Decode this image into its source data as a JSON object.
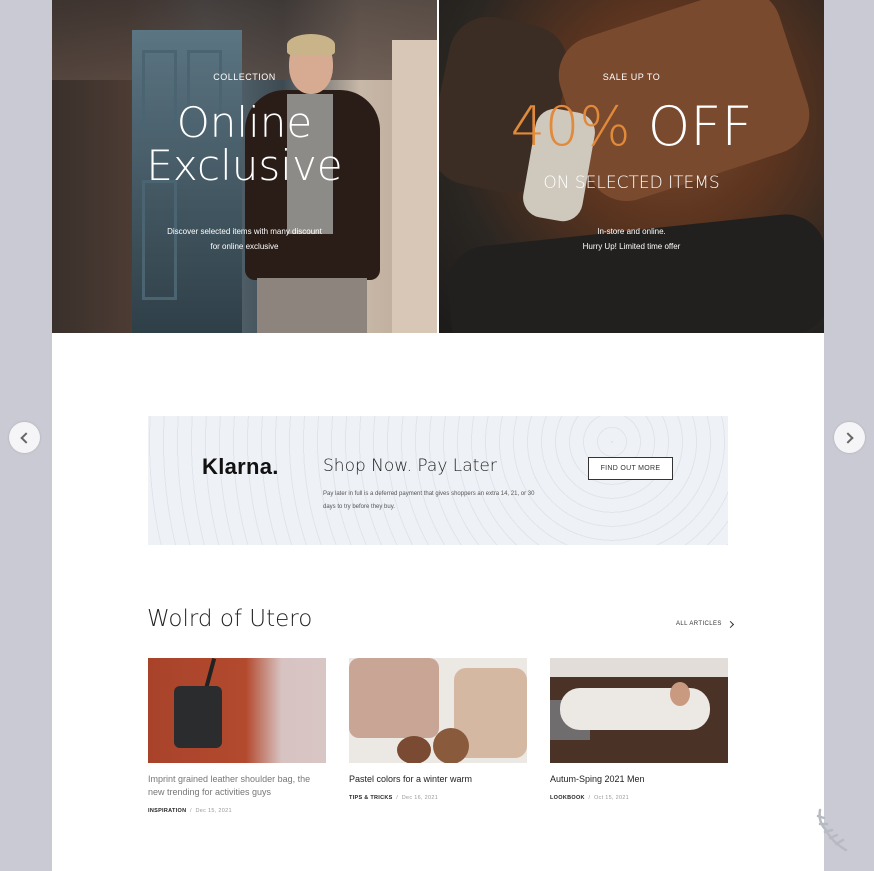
{
  "hero": {
    "left": {
      "label": "COLLECTION",
      "title_line1": "Online",
      "title_line2": "Exclusive",
      "desc_line1": "Discover selected items with many discount",
      "desc_line2": "for online exclusive"
    },
    "right": {
      "label": "SALE UP TO",
      "percent": "40%",
      "off": " OFF",
      "subtitle": "ON SELECTED ITEMS",
      "desc_line1": "In-store and online.",
      "desc_line2": "Hurry Up! Limited time offer"
    }
  },
  "klarna": {
    "logo": "Klarna.",
    "title": "Shop Now. Pay Later",
    "desc": "Pay later in full is a deferred payment that gives shoppers an extra 14, 21, or 30 days to try before they buy.",
    "button": "FIND OUT MORE"
  },
  "articles_section": {
    "title": "Wolrd of Utero",
    "all_link": "ALL ARTICLES",
    "items": [
      {
        "title": "Imprint grained leather shoulder bag, the new trending for activities guys",
        "category": "INSPIRATION",
        "date": "Dec 15, 2021"
      },
      {
        "title": "Pastel colors for a winter warm",
        "category": "TIPS & TRICKS",
        "date": "Dec 16, 2021"
      },
      {
        "title": "Autum-Sping 2021 Men",
        "category": "LOOKBOOK",
        "date": "Oct 15, 2021"
      }
    ]
  },
  "nav": {
    "prev_icon": "chevron-left-icon",
    "next_icon": "chevron-right-icon"
  },
  "colors": {
    "background": "#c9cad3",
    "accent": "#e08a3a",
    "banner": "#eef1f6"
  }
}
